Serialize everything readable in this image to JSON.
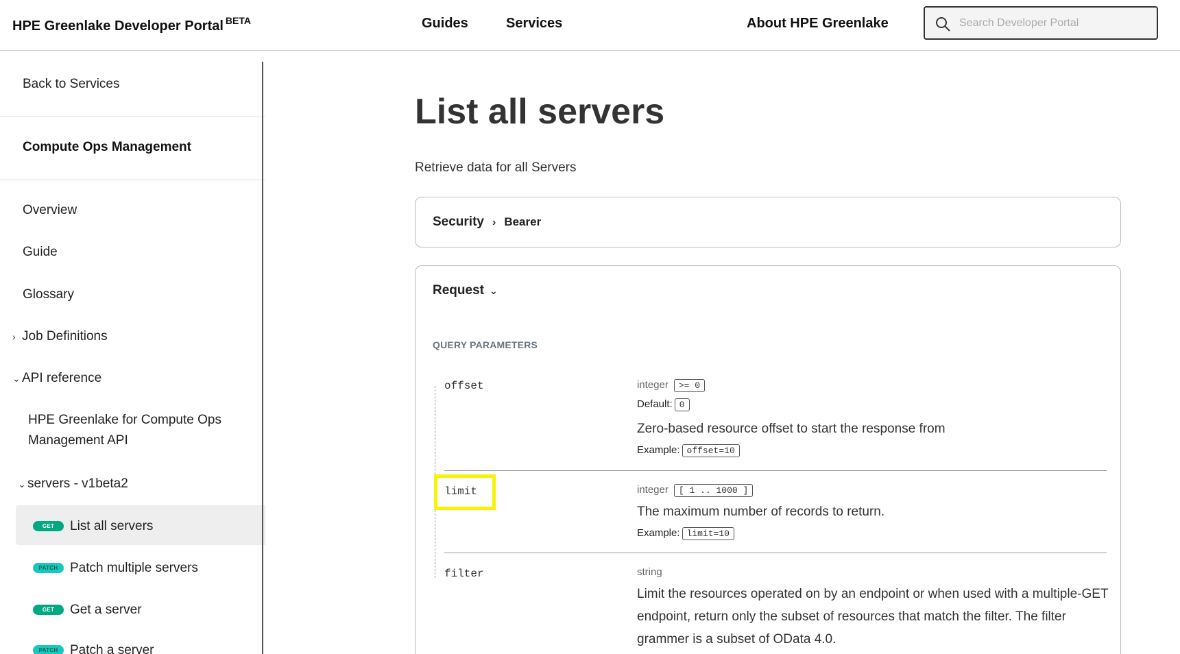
{
  "header": {
    "brand": "HPE Greenlake Developer Portal",
    "brand_sup": "BETA",
    "nav": [
      "Guides",
      "Services",
      "About HPE Greenlake"
    ],
    "search_placeholder": "Search Developer Portal"
  },
  "sidebar": {
    "back": "Back to Services",
    "section_title": "Compute Ops Management",
    "items": [
      "Overview",
      "Guide",
      "Glossary"
    ],
    "job_definitions": "Job Definitions",
    "api_reference": "API reference",
    "api_name": "HPE Greenlake for Compute Ops Management API",
    "servers_group": "servers - v1beta2",
    "operations": [
      {
        "method": "GET",
        "label": "List all servers"
      },
      {
        "method": "PATCH",
        "label": "Patch multiple servers"
      },
      {
        "method": "GET",
        "label": "Get a server"
      },
      {
        "method": "PATCH",
        "label": "Patch a server"
      }
    ]
  },
  "main": {
    "title": "List all servers",
    "description": "Retrieve data for all Servers",
    "security": {
      "label": "Security",
      "value": "Bearer"
    },
    "request": {
      "label": "Request"
    },
    "query_params_heading": "QUERY PARAMETERS",
    "params": [
      {
        "name": "offset",
        "type": "integer",
        "constraint": ">= 0",
        "default_label": "Default:",
        "default_value": "0",
        "description": "Zero-based resource offset to start the response from",
        "example_label": "Example:",
        "example": "offset=10"
      },
      {
        "name": "limit",
        "type": "integer",
        "constraint": "[ 1 .. 1000 ]",
        "description": "The maximum number of records to return.",
        "example_label": "Example:",
        "example": "limit=10"
      },
      {
        "name": "filter",
        "type": "string",
        "description": "Limit the resources operated on by an endpoint or when used with a multiple-GET endpoint, return only the subset of resources that match the filter. The filter grammer is a subset of OData 4.0."
      }
    ]
  }
}
